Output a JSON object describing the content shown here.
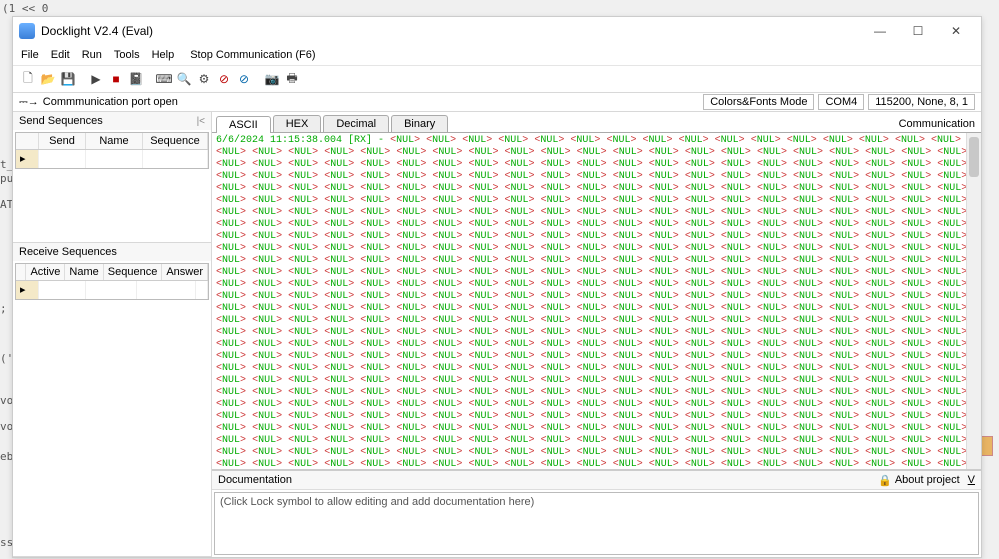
{
  "bg_snips": {
    "a": "(1 << 0",
    "b": "t_l",
    "c": "pu",
    "d": "AT",
    "e": ";",
    "f": "('",
    "g": "vo",
    "h": "vo",
    "i": "ebu",
    "j": "ssf"
  },
  "window": {
    "title": "Docklight V2.4 (Eval)",
    "menu": {
      "file": "File",
      "edit": "Edit",
      "run": "Run",
      "tools": "Tools",
      "help": "Help",
      "stop": "Stop Communication  (F6)"
    },
    "status": {
      "port_open": "Commmunication port open",
      "colors_fonts": "Colors&Fonts Mode",
      "port": "COM4",
      "settings": "115200, None, 8, 1"
    }
  },
  "send_seq": {
    "title": "Send Sequences",
    "collapse": "|<",
    "cols": {
      "send": "Send",
      "name": "Name",
      "seq": "Sequence"
    }
  },
  "recv_seq": {
    "title": "Receive Sequences",
    "cols": {
      "active": "Active",
      "name": "Name",
      "seq": "Sequence",
      "answer": "Answer"
    }
  },
  "comm": {
    "tabs": {
      "ascii": "ASCII",
      "hex": "HEX",
      "decimal": "Decimal",
      "binary": "Binary"
    },
    "label": "Communication",
    "timestamp": "6/6/2024 11:15:38.004",
    "rx": "[RX]",
    "sep": " - "
  },
  "doc": {
    "title": "Documentation",
    "about": "About project",
    "vbtn": "V",
    "placeholder": "(Click Lock symbol to allow editing and add documentation here)"
  }
}
